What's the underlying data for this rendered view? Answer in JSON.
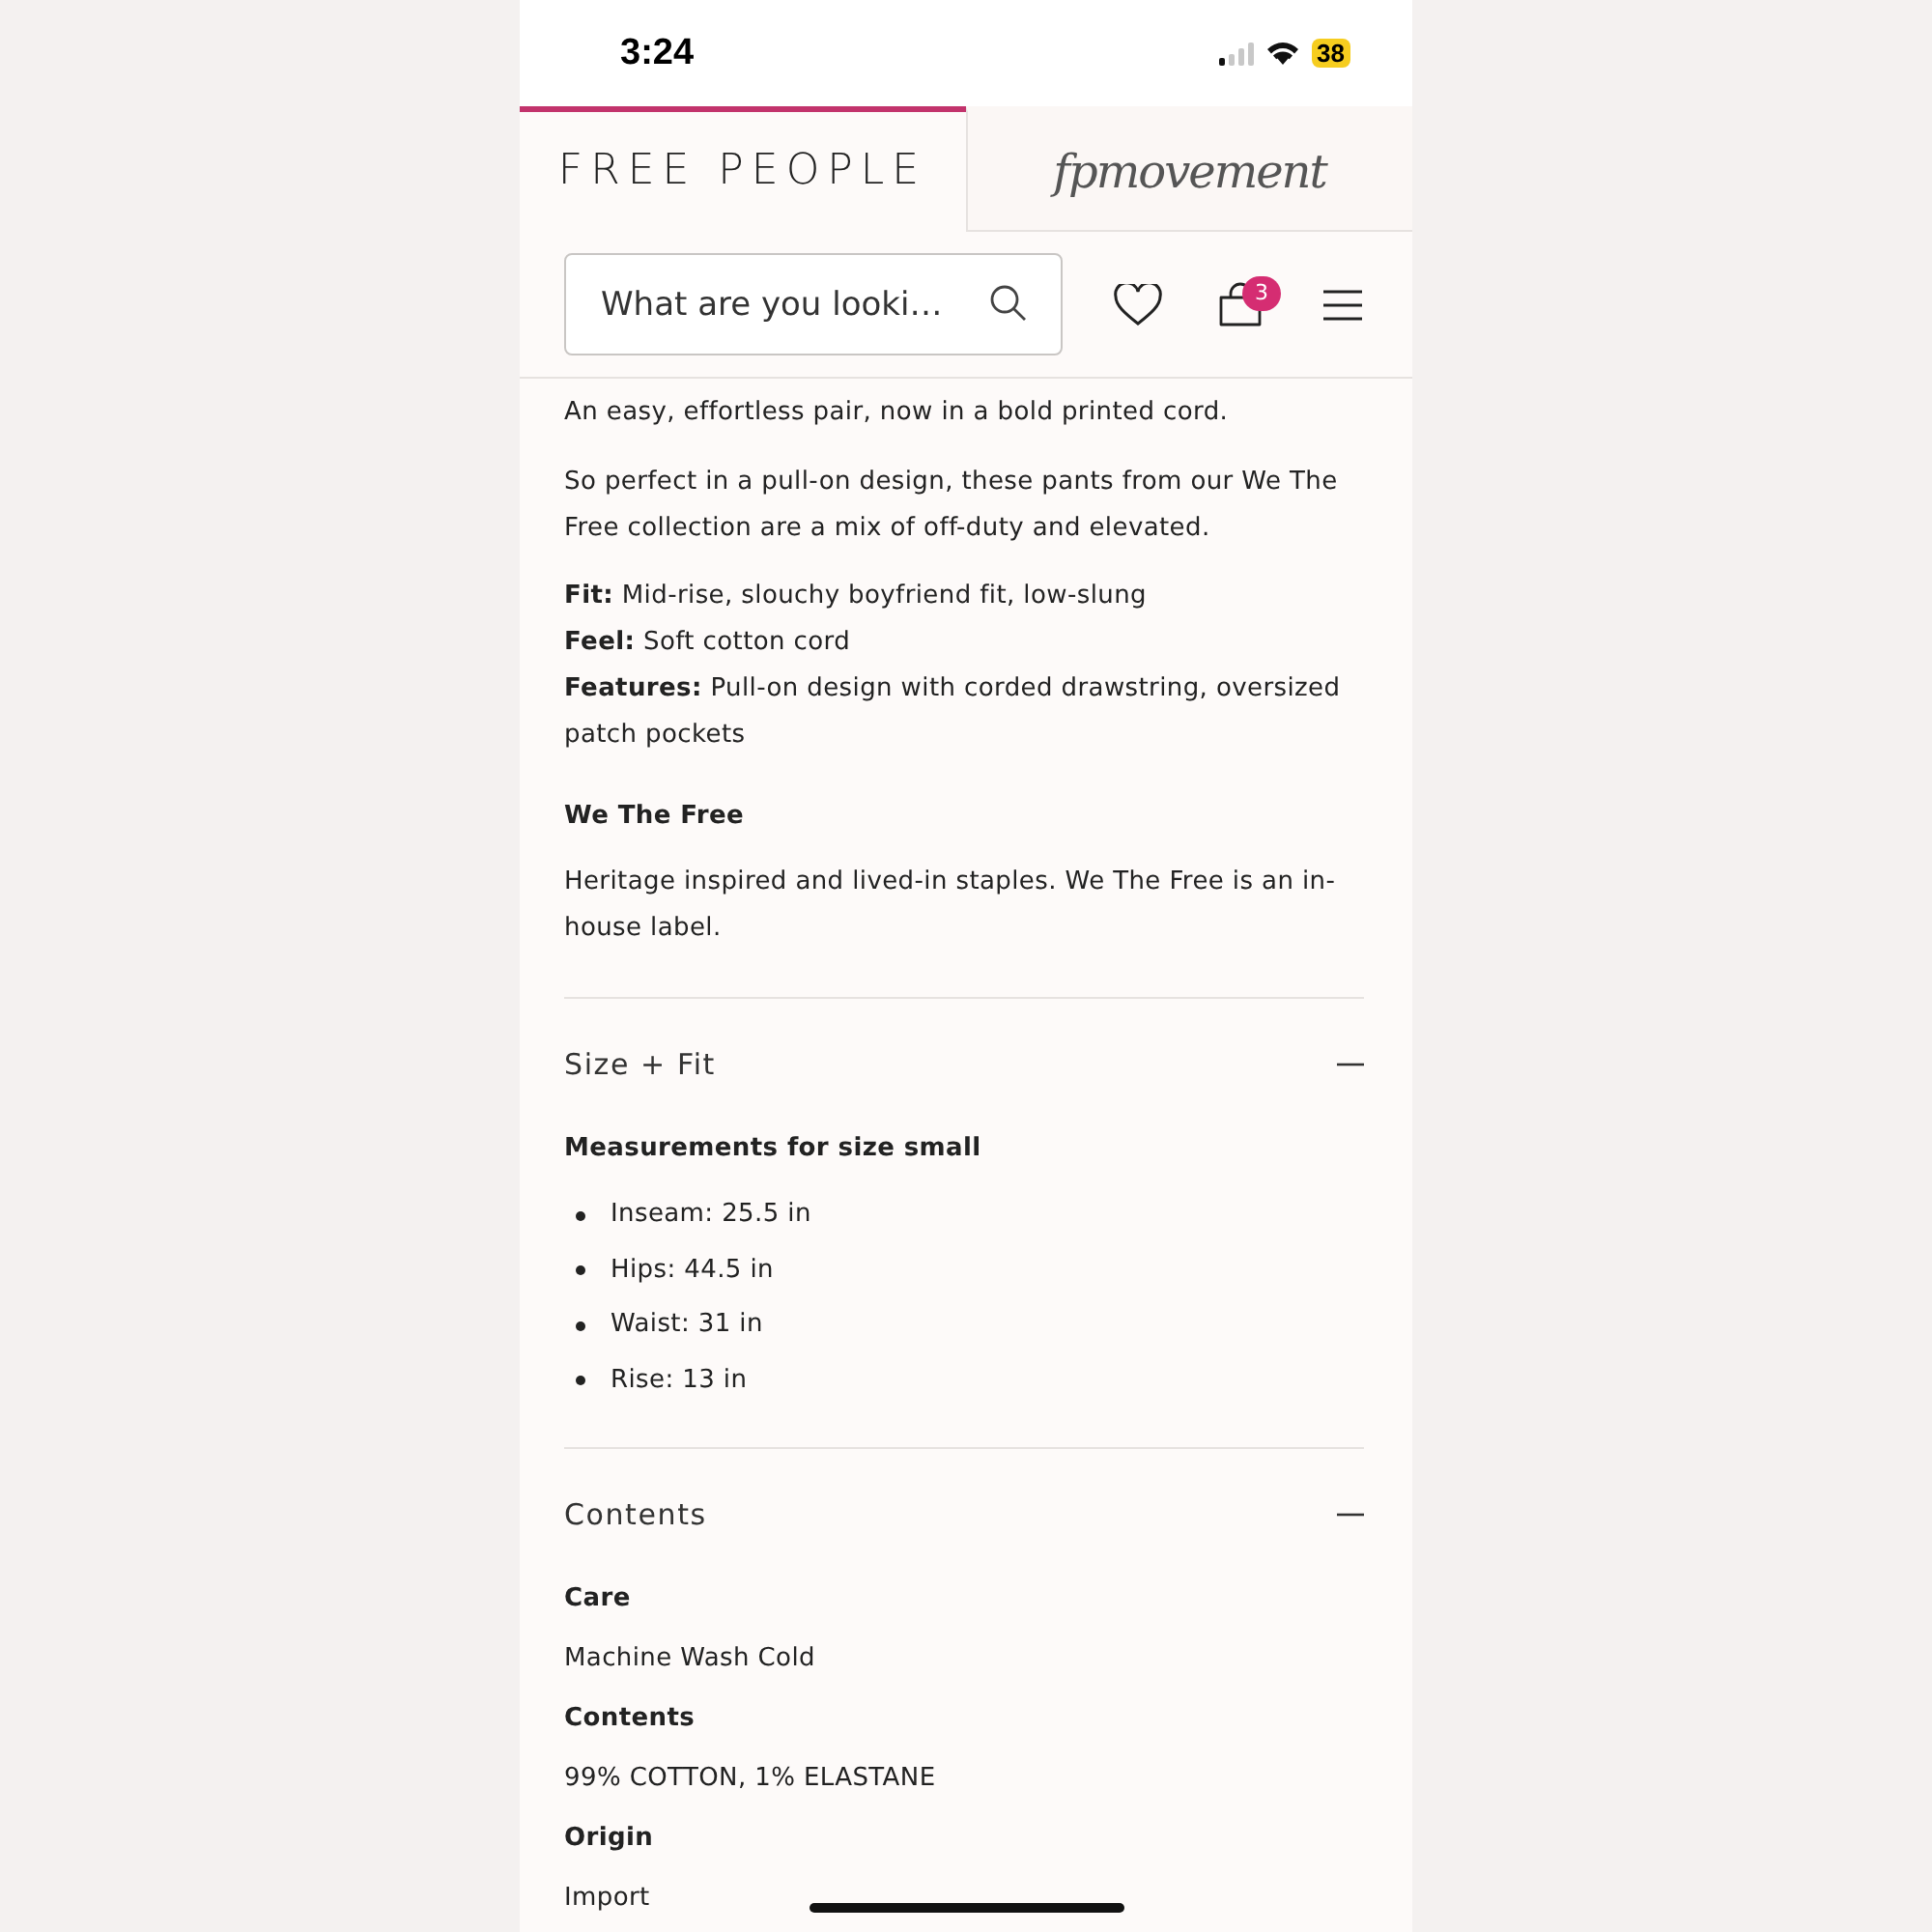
{
  "status_bar": {
    "time": "3:24",
    "battery": "38"
  },
  "brand_tabs": [
    {
      "label": "FREE PEOPLE",
      "kind": "wordmark",
      "selected": true
    },
    {
      "label": "fpmovement",
      "kind": "script",
      "selected": false
    }
  ],
  "header": {
    "search": {
      "placeholder": "What are you looki…"
    },
    "cart_count": "3"
  },
  "description": [
    {
      "kind": "paragraph",
      "text": "An easy, effortless pair, now in a bold printed cord."
    },
    {
      "kind": "paragraph",
      "text": "So perfect in a pull-on design, these pants from our We The Free collection are a mix of off-duty and elevated."
    },
    {
      "kind": "lines",
      "items": [
        "**Fit:** Mid-rise, slouchy boyfriend fit, low-slung",
        "**Feel:** Soft cotton cord",
        "**Features:** Pull-on design with corded drawstring, oversized patch pockets"
      ]
    },
    {
      "kind": "heading",
      "text": "We The Free"
    },
    {
      "kind": "paragraph",
      "text": "Heritage inspired and lived-in staples. We The Free is an in-house label."
    }
  ],
  "sections": [
    {
      "title": "Size + Fit",
      "expanded": true,
      "blocks": [
        {
          "kind": "heading",
          "text": "Measurements for size small"
        },
        {
          "kind": "bullets",
          "items": [
            "Inseam: 25.5 in",
            "Hips: 44.5 in",
            "Waist: 31 in",
            "Rise: 13 in"
          ]
        }
      ]
    },
    {
      "title": "Contents",
      "expanded": true,
      "blocks": [
        {
          "kind": "label",
          "text": "Care"
        },
        {
          "kind": "value",
          "text": "Machine Wash Cold"
        },
        {
          "kind": "label",
          "text": "Contents"
        },
        {
          "kind": "value",
          "text": "99% COTTON, 1% ELASTANE"
        },
        {
          "kind": "label",
          "text": "Origin"
        },
        {
          "kind": "value",
          "text": "Import"
        }
      ]
    }
  ]
}
